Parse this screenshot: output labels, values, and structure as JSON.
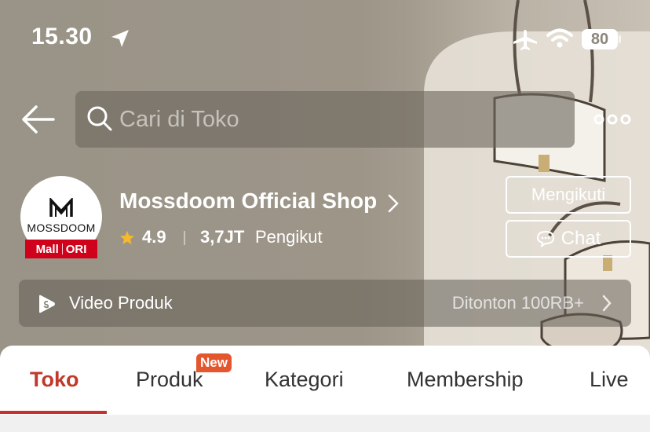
{
  "status_bar": {
    "time": "15.30",
    "battery": "80",
    "icons": [
      "location-arrow-icon",
      "airplane-icon",
      "wifi-icon",
      "battery-icon"
    ]
  },
  "header": {
    "search_placeholder": "Cari di Toko",
    "icons": [
      "back-arrow-icon",
      "search-icon",
      "more-icon"
    ]
  },
  "shop": {
    "logo_text": "MOSSDOOM",
    "badge_mall": "Mall",
    "badge_ori": "ORI",
    "name": "Mossdoom Official Shop",
    "rating": "4.9",
    "followers_count": "3,7JT",
    "followers_label": "Pengikut",
    "follow_label": "Mengikuti",
    "chat_label": "Chat"
  },
  "video": {
    "label": "Video Produk",
    "views": "Ditonton 100RB+"
  },
  "tabs": [
    {
      "label": "Toko",
      "active": true
    },
    {
      "label": "Produk",
      "badge": "New"
    },
    {
      "label": "Kategori"
    },
    {
      "label": "Membership"
    },
    {
      "label": "Live"
    }
  ],
  "colors": {
    "accent": "#c9302c",
    "badge": "#e4572e",
    "mall_badge": "#d0011b",
    "star": "#f5b82e"
  }
}
